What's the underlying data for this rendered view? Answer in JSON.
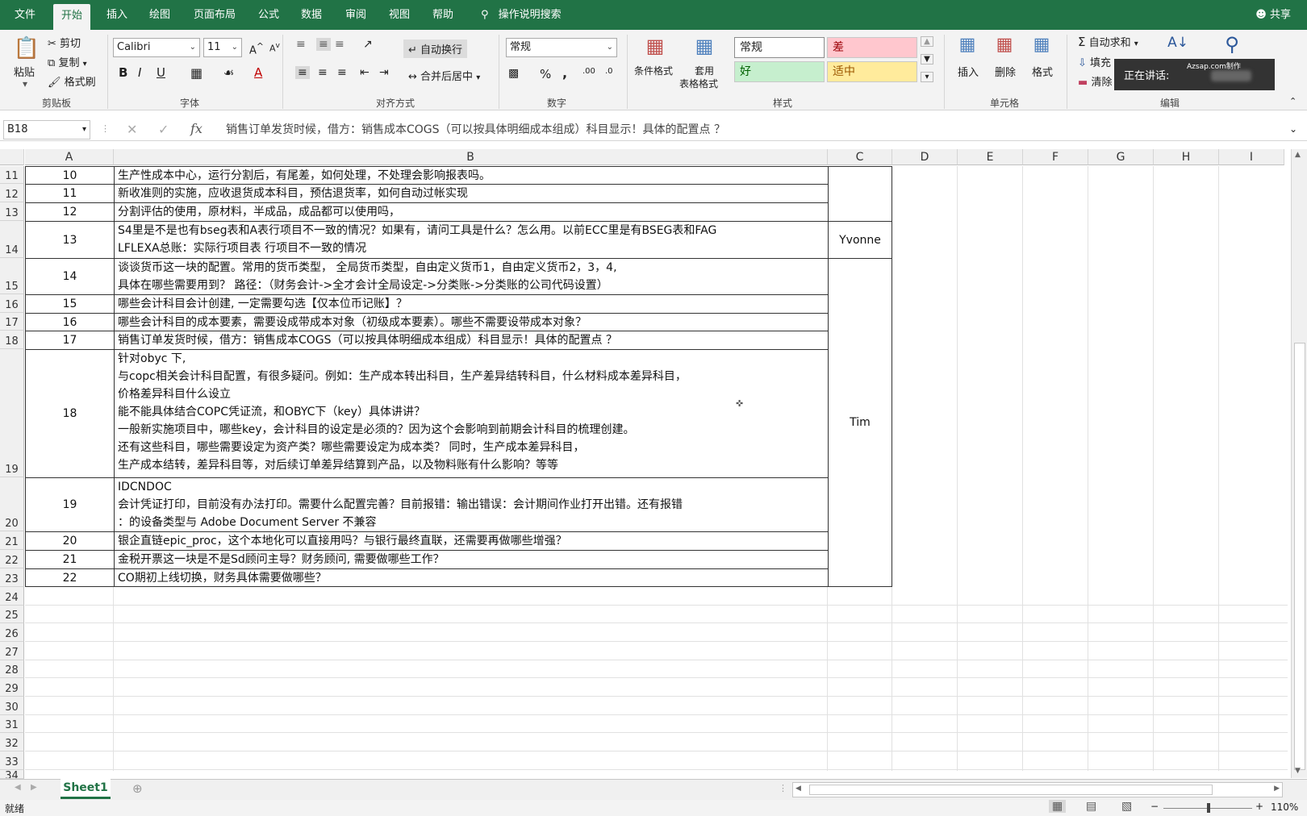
{
  "tabs": [
    "文件",
    "开始",
    "插入",
    "绘图",
    "页面布局",
    "公式",
    "数据",
    "审阅",
    "视图",
    "帮助"
  ],
  "tell_me": "操作说明搜索",
  "share": "共享",
  "clipboard": {
    "paste": "粘贴",
    "cut": "剪切",
    "copy": "复制",
    "painter": "格式刷",
    "label": "剪贴板"
  },
  "font": {
    "name": "Calibri",
    "size": "11",
    "bold": "B",
    "italic": "I",
    "underline": "U",
    "label": "字体"
  },
  "alignment": {
    "wrap": "自动换行",
    "merge": "合并后居中",
    "label": "对齐方式"
  },
  "number": {
    "format": "常规",
    "percent": "%",
    "comma": ",",
    "label": "数字"
  },
  "styles": {
    "conditional": "条件格式",
    "table_1": "套用",
    "table_2": "表格格式",
    "normal": "常规",
    "bad": "差",
    "good": "好",
    "neutral": "适中",
    "label": "样式"
  },
  "cells": {
    "insert": "插入",
    "delete": "删除",
    "format": "格式",
    "label": "单元格"
  },
  "editing": {
    "autosum": "自动求和",
    "fill": "填充",
    "clear": "清除",
    "label": "编辑"
  },
  "speaking": {
    "label": "正在讲话:",
    "brand": "Azsap.com制作"
  },
  "formula_bar": {
    "name_box": "B18",
    "formula": "销售订单发货时候，借方：销售成本COGS（可以按具体明细成本组成）科目显示！具体的配置点 ？"
  },
  "columns": [
    "A",
    "B",
    "C",
    "D",
    "E",
    "F",
    "G",
    "H",
    "I"
  ],
  "rows": [
    {
      "num": "11",
      "a": "10",
      "b": [
        "生产性成本中心，运行分割后，有尾差，如何处理，不处理会影响报表吗。"
      ]
    },
    {
      "num": "12",
      "a": "11",
      "b": [
        "新收准则的实施，应收退货成本科目，预估退货率，如何自动过帐实现"
      ]
    },
    {
      "num": "13",
      "a": "12",
      "b": [
        "分割评估的使用，原材料，半成品，成品都可以使用吗，"
      ]
    },
    {
      "num": "14",
      "a": "13",
      "b": [
        "S4里是不是也有bseg表和A表行项目不一致的情况？如果有，请问工具是什么？怎么用。以前ECC里是有BSEG表和FAG",
        "LFLEXA总账：实际行项目表 行项目不一致的情况"
      ]
    },
    {
      "num": "15",
      "a": "14",
      "b": [
        "谈谈货币这一块的配置。常用的货币类型， 全局货币类型，自由定义货币1，自由定义货币2，3，4,",
        "具体在哪些需要用到？ 路径：（财务会计->全才会计全局设定->分类账->分类账的公司代码设置）"
      ]
    },
    {
      "num": "16",
      "a": "15",
      "b": [
        "哪些会计科目会计创建, 一定需要勾选【仅本位币记账】？"
      ]
    },
    {
      "num": "17",
      "a": "16",
      "b": [
        "哪些会计科目的成本要素，需要设成带成本对象（初级成本要素）。哪些不需要设带成本对象？"
      ]
    },
    {
      "num": "18",
      "a": "17",
      "b": [
        "销售订单发货时候，借方：销售成本COGS（可以按具体明细成本组成）科目显示！具体的配置点 ？"
      ]
    },
    {
      "num": "19",
      "a": "18",
      "b": [
        "针对obyc 下,",
        "与copc相关会计科目配置，有很多疑问。例如：生产成本转出科目，生产差异结转科目，什么材料成本差异科目，",
        "价格差异科目什么设立",
        "能不能具体结合COPC凭证流，和OBYC下（key）具体讲讲？",
        "一般新实施项目中，哪些key，会计科目的设定是必须的？因为这个会影响到前期会计科目的梳理创建。",
        "还有这些科目，哪些需要设定为资产类？哪些需要设定为成本类？ 同时，生产成本差异科目，",
        "生产成本结转，差异科目等，对后续订单差异结算到产品，以及物料账有什么影响？等等"
      ]
    },
    {
      "num": "20",
      "a": "19",
      "b": [
        "IDCNDOC",
        "会计凭证打印，目前没有办法打印。需要什么配置完善？目前报错：输出错误：会计期间作业打开出错。还有报错",
        "：的设备类型与 Adobe Document Server 不兼容"
      ]
    },
    {
      "num": "21",
      "a": "20",
      "b": [
        "银企直链epic_proc，这个本地化可以直接用吗？与银行最终直联，还需要再做哪些增强？"
      ]
    },
    {
      "num": "22",
      "a": "21",
      "b": [
        "金税开票这一块是不是Sd顾问主导？财务顾问, 需要做哪些工作？"
      ]
    },
    {
      "num": "23",
      "a": "22",
      "b": [
        "CO期初上线切换，财务具体需要做哪些？"
      ]
    }
  ],
  "empty_rows": [
    "24",
    "25",
    "26",
    "27",
    "28",
    "29",
    "30",
    "31",
    "32",
    "33",
    "34"
  ],
  "merged_c": [
    {
      "text": "Yvonne"
    },
    {
      "text": "Tim"
    }
  ],
  "sheet_tab": "Sheet1",
  "status": {
    "ready": "就绪",
    "zoom": "110%"
  },
  "colors": {
    "accent": "#217346",
    "bad_bg": "#ffc7ce",
    "good_bg": "#c6efce",
    "neutral_bg": "#ffeb9c"
  }
}
